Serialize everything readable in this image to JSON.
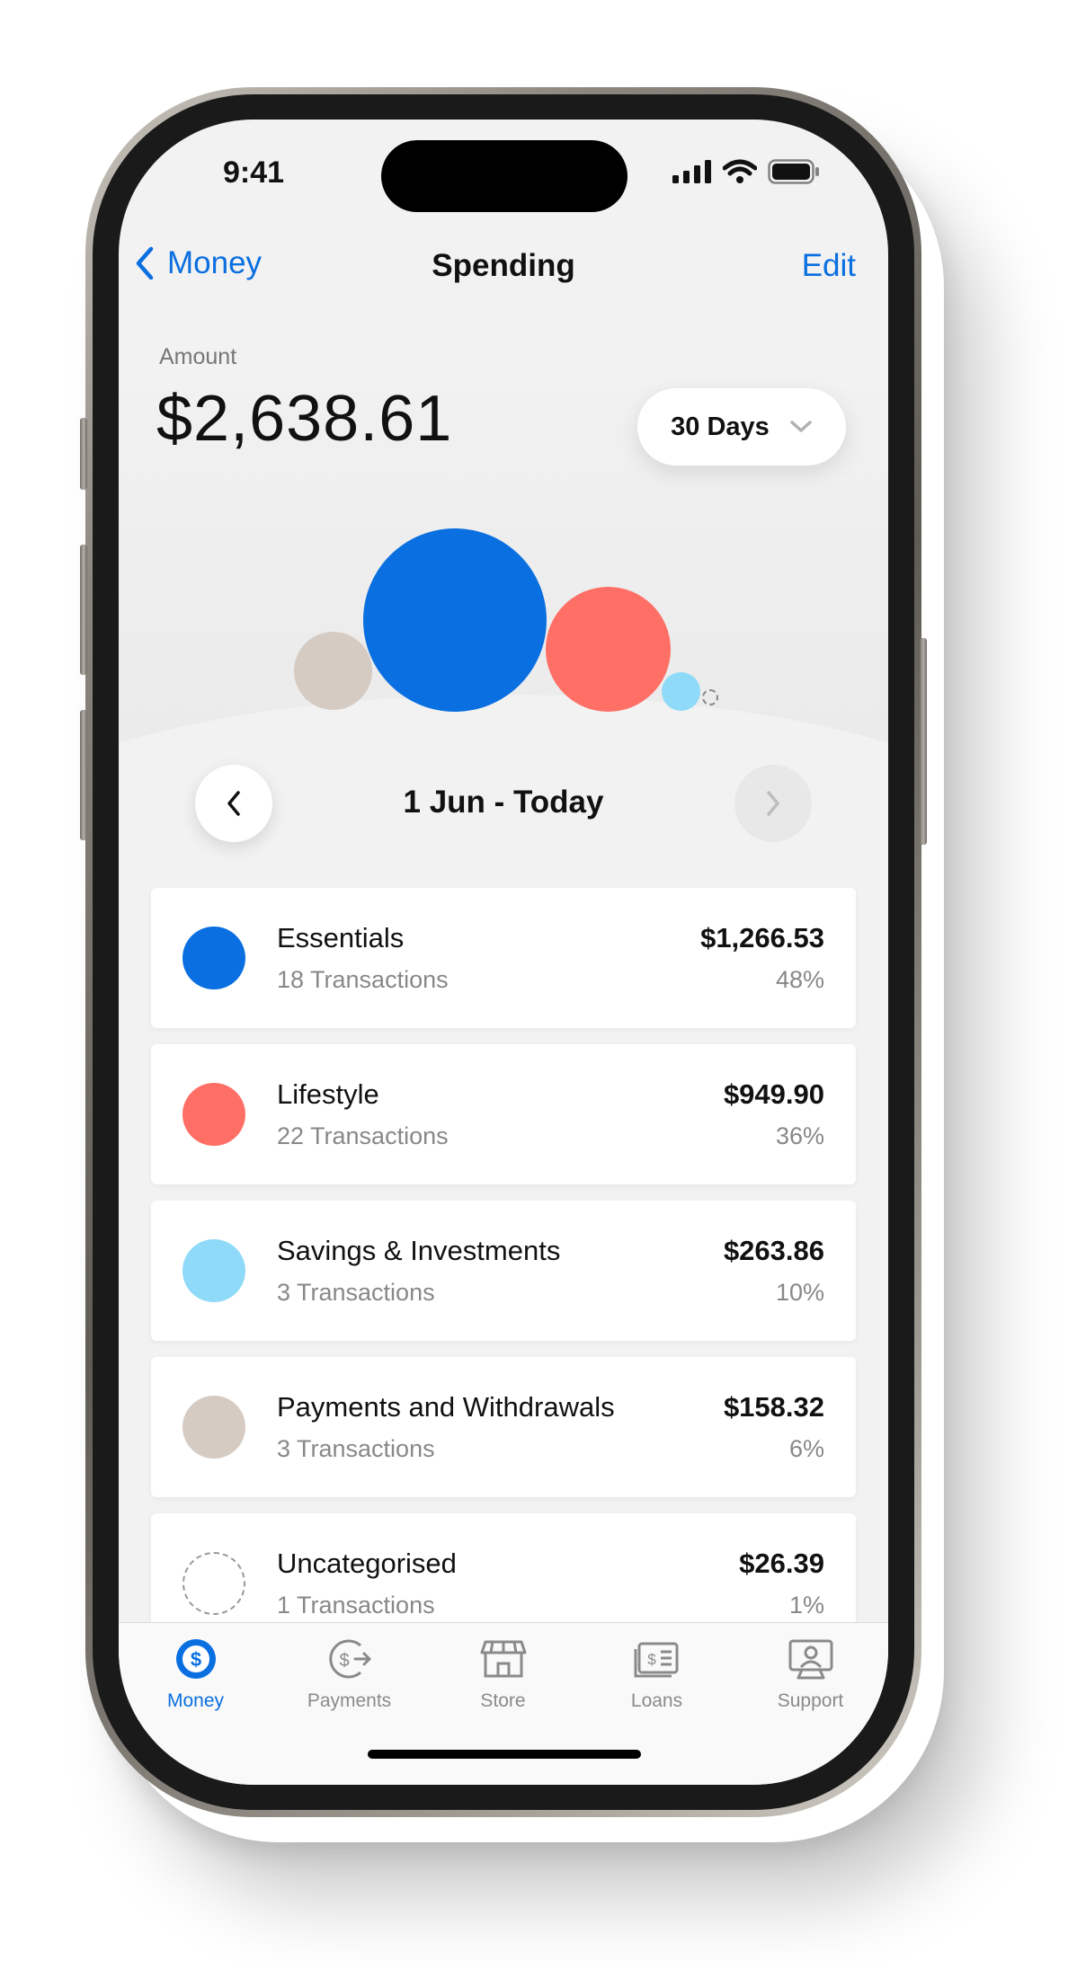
{
  "status_bar": {
    "time": "9:41"
  },
  "header": {
    "back_label": "Money",
    "title": "Spending",
    "edit_label": "Edit"
  },
  "summary": {
    "amount_label": "Amount",
    "amount_value": "$2,638.61",
    "period_label": "30 Days"
  },
  "date_nav": {
    "range_label": "1 Jun - Today"
  },
  "categories": [
    {
      "name": "Essentials",
      "transactions": "18 Transactions",
      "amount": "$1,266.53",
      "percent": "48%",
      "color": "#0a6fe0",
      "icon": "solid-dot"
    },
    {
      "name": "Lifestyle",
      "transactions": "22 Transactions",
      "amount": "$949.90",
      "percent": "36%",
      "color": "#ff6f66",
      "icon": "solid-dot"
    },
    {
      "name": "Savings & Investments",
      "transactions": "3 Transactions",
      "amount": "$263.86",
      "percent": "10%",
      "color": "#8fdaf8",
      "icon": "solid-dot"
    },
    {
      "name": "Payments and Withdrawals",
      "transactions": "3 Transactions",
      "amount": "$158.32",
      "percent": "6%",
      "color": "#d5cbc3",
      "icon": "solid-dot"
    },
    {
      "name": "Uncategorised",
      "transactions": "1 Transactions",
      "amount": "$26.39",
      "percent": "1%",
      "color": "#999999",
      "icon": "dashed-dot"
    }
  ],
  "tab_bar": {
    "tabs": [
      {
        "label": "Money",
        "icon": "money-icon",
        "active": true
      },
      {
        "label": "Payments",
        "icon": "payments-icon",
        "active": false
      },
      {
        "label": "Store",
        "icon": "store-icon",
        "active": false
      },
      {
        "label": "Loans",
        "icon": "loans-icon",
        "active": false
      },
      {
        "label": "Support",
        "icon": "support-icon",
        "active": false
      }
    ]
  },
  "colors": {
    "accent": "#0a6fe0",
    "essentials": "#0a6fe0",
    "lifestyle": "#ff6f66",
    "savings": "#8fdaf8",
    "payments": "#d5cbc3",
    "uncategorised": "#999999"
  }
}
